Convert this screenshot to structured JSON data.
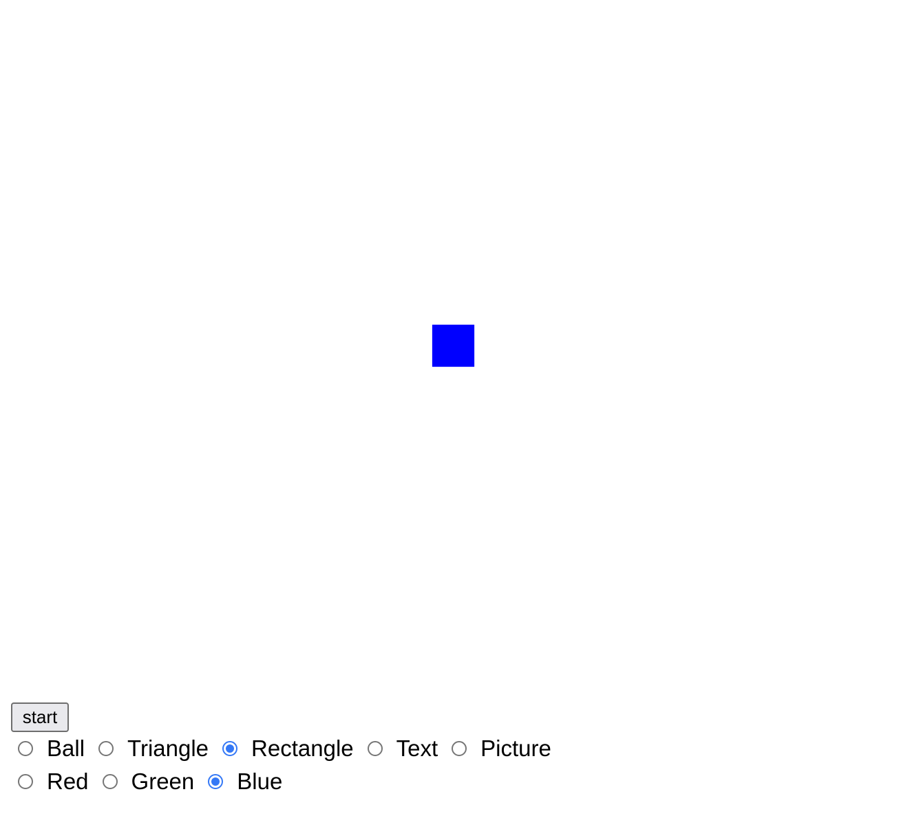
{
  "canvas": {
    "shape_kind": "Rectangle",
    "shape_color": "#0000ff"
  },
  "controls": {
    "start_label": "start",
    "shape_options": [
      {
        "label": "Ball",
        "checked": false
      },
      {
        "label": "Triangle",
        "checked": false
      },
      {
        "label": "Rectangle",
        "checked": true
      },
      {
        "label": "Text",
        "checked": false
      },
      {
        "label": "Picture",
        "checked": false
      }
    ],
    "color_options": [
      {
        "label": "Red",
        "checked": false
      },
      {
        "label": "Green",
        "checked": false
      },
      {
        "label": "Blue",
        "checked": true
      }
    ]
  },
  "colors": {
    "radio_accent": "#3478f6",
    "button_bg": "#e9e9ed"
  }
}
